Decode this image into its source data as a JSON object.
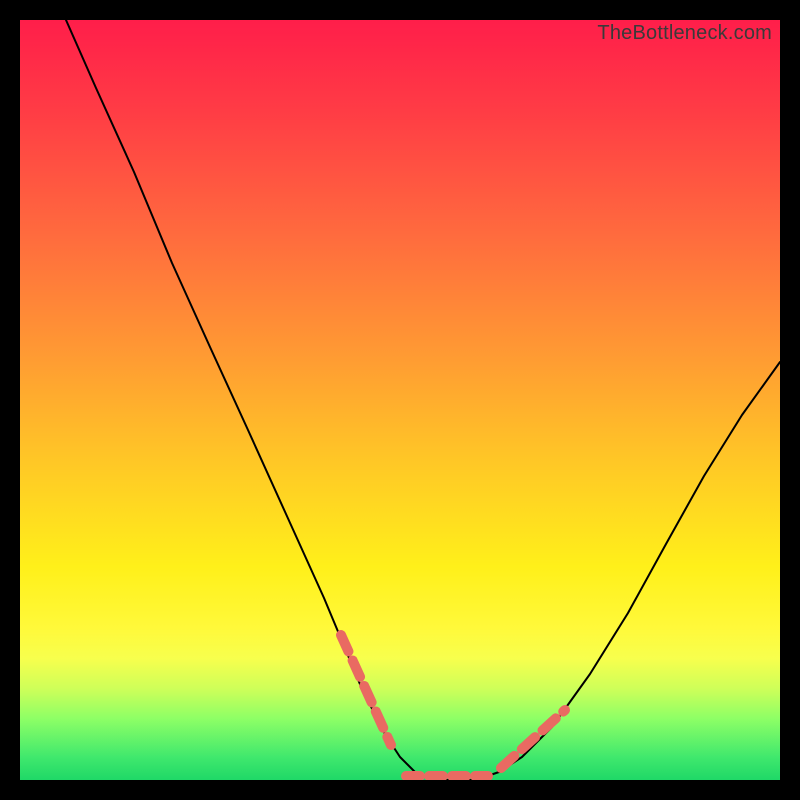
{
  "watermark": {
    "text": "TheBottleneck.com"
  },
  "chart_data": {
    "type": "line",
    "title": "",
    "xlabel": "",
    "ylabel": "",
    "xlim": [
      0,
      100
    ],
    "ylim": [
      0,
      100
    ],
    "grid": false,
    "legend": false,
    "series": [
      {
        "name": "curve",
        "x": [
          6,
          10,
          15,
          20,
          25,
          30,
          35,
          40,
          45,
          48,
          50,
          52,
          55,
          58,
          60,
          63,
          66,
          70,
          75,
          80,
          85,
          90,
          95,
          100
        ],
        "y": [
          100,
          91,
          80,
          68,
          57,
          46,
          35,
          24,
          12,
          6,
          3,
          1,
          0,
          0,
          0,
          1,
          3,
          7,
          14,
          22,
          31,
          40,
          48,
          55
        ]
      }
    ],
    "markers": [
      {
        "name": "left-dashes",
        "approx_x_range": [
          42,
          49
        ],
        "approx_y_range": [
          4,
          20
        ],
        "color": "#e96a62"
      },
      {
        "name": "right-dashes",
        "approx_x_range": [
          63,
          71
        ],
        "approx_y_range": [
          3,
          20
        ],
        "color": "#e96a62"
      },
      {
        "name": "bottom-dashes",
        "approx_x_range": [
          50,
          61
        ],
        "approx_y_range": [
          0,
          2
        ],
        "color": "#e96a62"
      }
    ],
    "background": "vertical-gradient red→yellow→green"
  }
}
